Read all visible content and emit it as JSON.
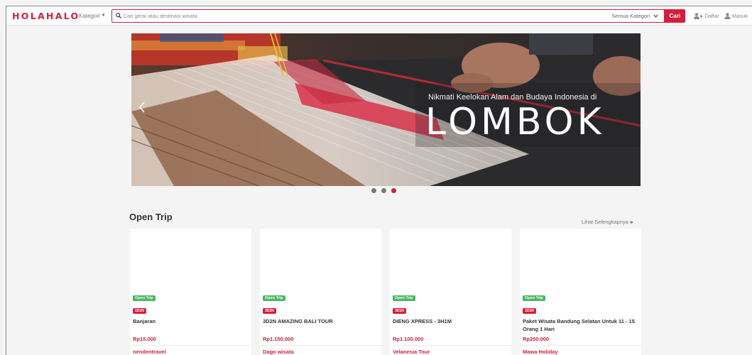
{
  "header": {
    "logo": "HOLAHALO",
    "kategori_label": "Kategori",
    "search": {
      "placeholder": "Cari gerai atau destinasi wisata",
      "value": ""
    },
    "category_select": "Semua Kategori",
    "search_button": "Cari",
    "register_label": "Daftar",
    "login_label": "Masuk"
  },
  "banner": {
    "subtitle": "Nikmati Keelokan Alam dan Budaya Indonesia di",
    "title": "LOMBOK",
    "slide_count": 3,
    "active_slide": 3
  },
  "open_trip": {
    "title": "Open Trip",
    "see_more": "Lihat Selengkapnya",
    "cards": [
      {
        "badge": "Open Trip",
        "days": "1D1N",
        "title": "Banjaran",
        "price": "Rp15.000",
        "vendor": "nendentravel"
      },
      {
        "badge": "Open Trip",
        "days": "3D2N",
        "title": "3D2N AMAZING BALI TOUR",
        "price": "Rp1.150.000",
        "vendor": "Dago wisata"
      },
      {
        "badge": "Open Trip",
        "days": "3D1N",
        "title": "DIENG XPRESS - 3H1M",
        "price": "Rp1.100.000",
        "vendor": "Velanesia Tour"
      },
      {
        "badge": "Open Trip",
        "days": "1D1N",
        "title": "Paket Wisata Bandung Selatan Untuk 11 - 15 Orang 1 Hari",
        "price": "Rp200.000",
        "vendor": "Mawa Holiday"
      }
    ]
  },
  "colors": {
    "brand": "#d21f3c",
    "badge_green": "#4ab464"
  },
  "icons": [
    "search-icon",
    "chevron-down-icon",
    "add-user-icon",
    "user-icon",
    "chevron-left-icon",
    "double-chevron-right-icon"
  ]
}
